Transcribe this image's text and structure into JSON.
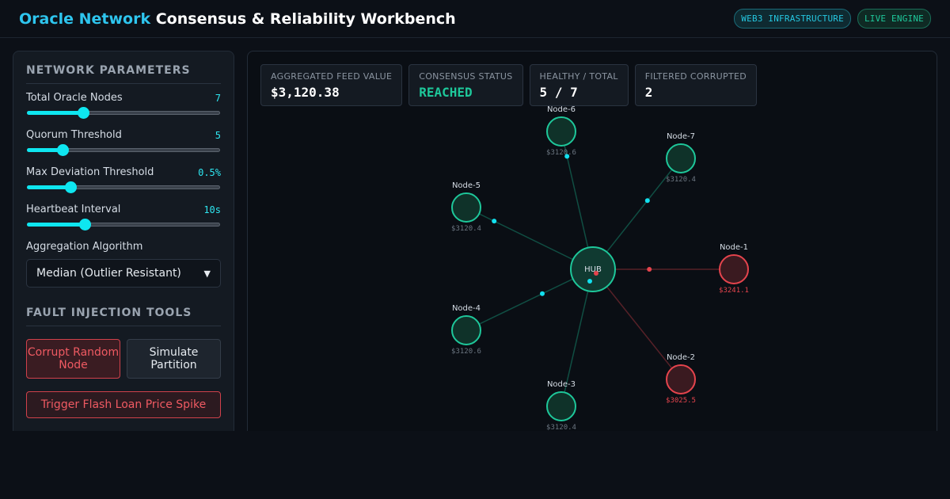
{
  "header": {
    "title_accent": "Oracle Network",
    "title_rest": "Consensus & Reliability Workbench",
    "badges": [
      "WEB3 INFRASTRUCTURE",
      "LIVE ENGINE"
    ]
  },
  "sidebar": {
    "network_title": "NETWORK PARAMETERS",
    "params": [
      {
        "label": "Total Oracle Nodes",
        "value": "7",
        "fraction": 0.29
      },
      {
        "label": "Quorum Threshold",
        "value": "5",
        "fraction": 0.185
      },
      {
        "label": "Max Deviation Threshold",
        "value": "0.5%",
        "fraction": 0.225
      },
      {
        "label": "Heartbeat Interval",
        "value": "10s",
        "fraction": 0.3
      }
    ],
    "aggregation_label": "Aggregation Algorithm",
    "aggregation_value": "Median (Outlier Resistant)",
    "fault_title": "FAULT INJECTION TOOLS",
    "corrupt_button": "Corrupt Random Node",
    "partition_button": "Simulate Partition",
    "spike_button": "Trigger Flash Loan Price Spike"
  },
  "stats": [
    {
      "label": "AGGREGATED FEED VALUE",
      "value": "$3,120.38"
    },
    {
      "label": "CONSENSUS STATUS",
      "value": "REACHED"
    },
    {
      "label": "HEALTHY / TOTAL",
      "value": "5 / 7"
    },
    {
      "label": "FILTERED CORRUPTED",
      "value": "2"
    }
  ],
  "graph": {
    "hub_label": "HUB",
    "colors": {
      "healthy": "#1ec79a",
      "corrupted": "#e5444d",
      "packet": "#12e0ef"
    },
    "nodes": [
      {
        "name": "Node-1",
        "price": "$3241.1",
        "status": "corrupted"
      },
      {
        "name": "Node-2",
        "price": "$3025.5",
        "status": "corrupted"
      },
      {
        "name": "Node-3",
        "price": "$3120.4",
        "status": "healthy"
      },
      {
        "name": "Node-4",
        "price": "$3120.6",
        "status": "healthy"
      },
      {
        "name": "Node-5",
        "price": "$3120.4",
        "status": "healthy"
      },
      {
        "name": "Node-6",
        "price": "$3120.6",
        "status": "healthy"
      },
      {
        "name": "Node-7",
        "price": "$3120.4",
        "status": "healthy"
      }
    ]
  }
}
